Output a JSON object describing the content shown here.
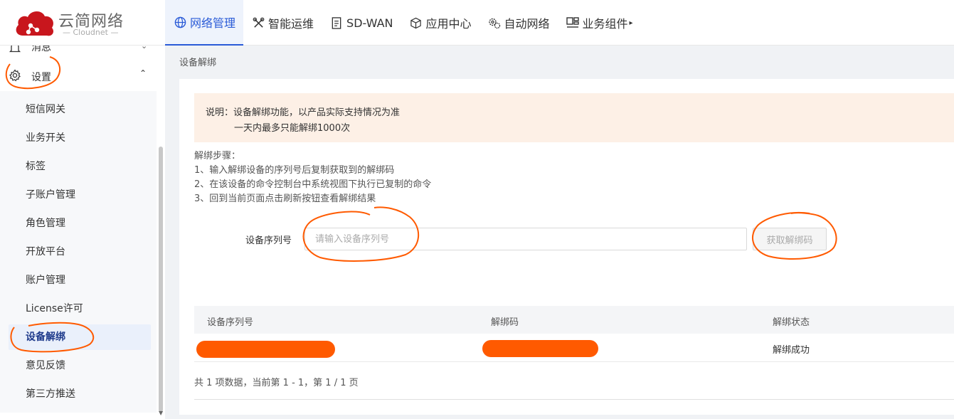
{
  "app": {
    "brand": "云简网络",
    "brand_sub": "— Cloudnet —"
  },
  "nav": {
    "items": [
      {
        "label": "网络管理",
        "icon": "globe-icon",
        "active": true
      },
      {
        "label": "智能运维",
        "icon": "tools-icon"
      },
      {
        "label": "SD-WAN",
        "icon": "document-icon"
      },
      {
        "label": "应用中心",
        "icon": "cube-icon"
      },
      {
        "label": "自动网络",
        "icon": "gears-icon"
      },
      {
        "label": "业务组件",
        "icon": "components-icon",
        "caret": "▸"
      }
    ]
  },
  "sidebar": {
    "prev_group": "消息",
    "group": {
      "label": "设置",
      "icon": "gear-icon"
    },
    "items": [
      {
        "label": "短信网关"
      },
      {
        "label": "业务开关"
      },
      {
        "label": "标签"
      },
      {
        "label": "子账户管理"
      },
      {
        "label": "角色管理"
      },
      {
        "label": "开放平台"
      },
      {
        "label": "账户管理"
      },
      {
        "label": "License许可"
      },
      {
        "label": "设备解绑",
        "active": true
      },
      {
        "label": "意见反馈"
      },
      {
        "label": "第三方推送"
      }
    ]
  },
  "main": {
    "breadcrumb": "设备解绑",
    "notice": {
      "line1": "说明：设备解绑功能，以产品实际支持情况为准",
      "line2": "一天内最多只能解绑1000次"
    },
    "steps": {
      "title": "解绑步骤：",
      "s1": "1、输入解绑设备的序列号后复制获取到的解绑码",
      "s2": "2、在该设备的命令控制台中系统视图下执行已复制的命令",
      "s3": "3、回到当前页面点击刷新按钮查看解绑结果"
    },
    "form": {
      "label": "设备序列号",
      "placeholder": "请输入设备序列号",
      "value": "",
      "button": "获取解绑码"
    },
    "table": {
      "columns": [
        "设备序列号",
        "解绑码",
        "解绑状态"
      ],
      "rows": [
        {
          "serial": "",
          "code": "",
          "status": "解绑成功"
        }
      ]
    },
    "pagination": "共 1 项数据，当前第 1 - 1，第 1 / 1 页"
  },
  "colors": {
    "accent": "#2a5bd7",
    "logo_red": "#c8161d",
    "annotation": "#ff5a00",
    "notice_bg": "#fdf0e6"
  }
}
